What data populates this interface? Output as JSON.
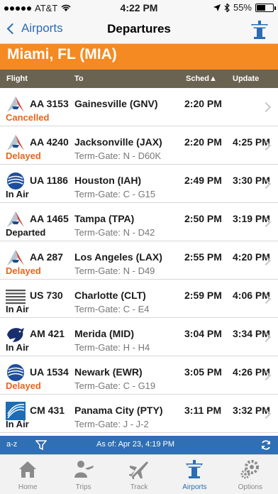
{
  "status_bar": {
    "carrier": "AT&T",
    "time": "4:22 PM",
    "battery": "55%",
    "battery_level": 0.55
  },
  "nav": {
    "back_label": "Airports",
    "title": "Departures"
  },
  "airport": {
    "name": "Miami, FL (MIA)"
  },
  "columns": {
    "flight": "Flight",
    "to": "To",
    "sched": "Sched▲",
    "update": "Update"
  },
  "flights": [
    {
      "logo": "american-airlines-logo",
      "flight": "AA 3153",
      "dest": "Gainesville (GNV)",
      "gate": "",
      "sched": "2:20 PM",
      "update": "",
      "status": "Cancelled",
      "status_color": "#e8651d"
    },
    {
      "logo": "american-airlines-logo",
      "flight": "AA 4240",
      "dest": "Jacksonville (JAX)",
      "gate": "Term-Gate: N - D60K",
      "sched": "2:20 PM",
      "update": "4:25 PM",
      "status": "Delayed",
      "status_color": "#e8651d"
    },
    {
      "logo": "united-airlines-logo",
      "flight": "UA 1186",
      "dest": "Houston (IAH)",
      "gate": "Term-Gate: C - G15",
      "sched": "2:49 PM",
      "update": "3:30 PM",
      "status": "In Air",
      "status_color": "#1a1a1a"
    },
    {
      "logo": "american-airlines-logo",
      "flight": "AA 1465",
      "dest": "Tampa (TPA)",
      "gate": "Term-Gate: N - D42",
      "sched": "2:50 PM",
      "update": "3:19 PM",
      "status": "Departed",
      "status_color": "#1a1a1a"
    },
    {
      "logo": "american-airlines-logo",
      "flight": "AA 287",
      "dest": "Los Angeles (LAX)",
      "gate": "Term-Gate: N - D49",
      "sched": "2:55 PM",
      "update": "4:20 PM",
      "status": "Delayed",
      "status_color": "#e8651d"
    },
    {
      "logo": "us-airways-logo",
      "flight": "US 730",
      "dest": "Charlotte (CLT)",
      "gate": "Term-Gate: C - E4",
      "sched": "2:59 PM",
      "update": "4:06 PM",
      "status": "In Air",
      "status_color": "#1a1a1a"
    },
    {
      "logo": "aeromexico-logo",
      "flight": "AM 421",
      "dest": "Merida (MID)",
      "gate": "Term-Gate: H - H4",
      "sched": "3:04 PM",
      "update": "3:34 PM",
      "status": "In Air",
      "status_color": "#1a1a1a"
    },
    {
      "logo": "united-airlines-logo",
      "flight": "UA 1534",
      "dest": "Newark (EWR)",
      "gate": "Term-Gate: C - G19",
      "sched": "3:05 PM",
      "update": "4:26 PM",
      "status": "Delayed",
      "status_color": "#e8651d"
    },
    {
      "logo": "copa-airlines-logo",
      "flight": "CM 431",
      "dest": "Panama City (PTY)",
      "gate": "Term-Gate: J - J-2",
      "sched": "3:11 PM",
      "update": "3:32 PM",
      "status": "In Air",
      "status_color": "#1a1a1a"
    }
  ],
  "info_bar": {
    "sort_label": "a-z",
    "as_of": "As of: Apr 23, 4:19 PM"
  },
  "tabs": [
    {
      "label": "Home",
      "icon": "house-icon"
    },
    {
      "label": "Trips",
      "icon": "person-icon"
    },
    {
      "label": "Track",
      "icon": "plane-icon"
    },
    {
      "label": "Airports",
      "icon": "control-tower-icon",
      "active": true
    },
    {
      "label": "Options",
      "icon": "gears-icon"
    }
  ],
  "colors": {
    "accent": "#2a6db5",
    "airport_header": "#f58a23",
    "column_header": "#6b6352",
    "info_bar": "#2f6fb3",
    "delayed": "#e8651d"
  }
}
